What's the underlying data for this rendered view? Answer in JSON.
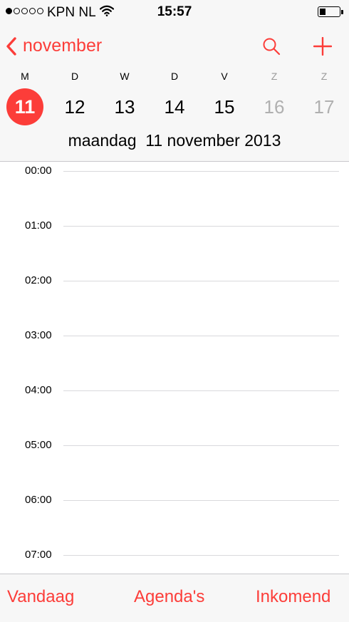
{
  "status_bar": {
    "signal_dots_filled": 1,
    "signal_dots_total": 5,
    "carrier": "KPN NL",
    "time": "15:57",
    "battery_level": 0.3
  },
  "nav": {
    "back_label": "november",
    "back_icon": "chevron-left-icon",
    "search_icon": "search-icon",
    "add_icon": "plus-icon"
  },
  "week": {
    "days": [
      {
        "weekday": "M",
        "date": "11",
        "selected": true,
        "weekend": false
      },
      {
        "weekday": "D",
        "date": "12",
        "selected": false,
        "weekend": false
      },
      {
        "weekday": "W",
        "date": "13",
        "selected": false,
        "weekend": false
      },
      {
        "weekday": "D",
        "date": "14",
        "selected": false,
        "weekend": false
      },
      {
        "weekday": "V",
        "date": "15",
        "selected": false,
        "weekend": false
      },
      {
        "weekday": "Z",
        "date": "16",
        "selected": false,
        "weekend": true
      },
      {
        "weekday": "Z",
        "date": "17",
        "selected": false,
        "weekend": true
      }
    ],
    "full_date": "maandag  11 november 2013"
  },
  "timeline": {
    "hours": [
      "00:00",
      "01:00",
      "02:00",
      "03:00",
      "04:00",
      "05:00",
      "06:00",
      "07:00"
    ]
  },
  "tab_bar": {
    "today": "Vandaag",
    "calendars": "Agenda's",
    "inbox": "Inkomend"
  },
  "colors": {
    "accent": "#fc3d39",
    "weekend_text": "#b0b0b0",
    "separator": "#d9d9dc",
    "bar_background": "#f7f7f7"
  }
}
